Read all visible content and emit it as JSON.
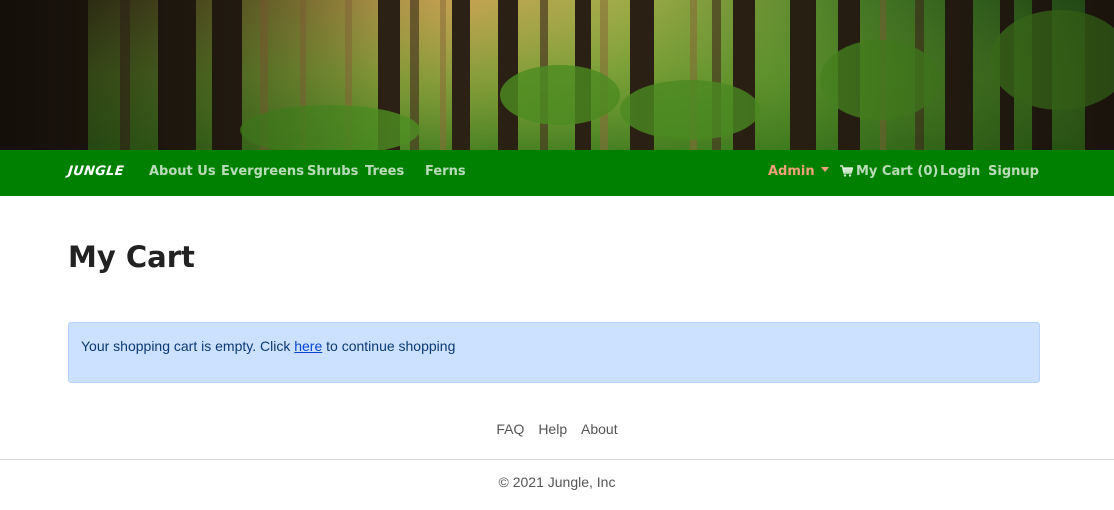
{
  "navbar": {
    "brand": "JUNGLE",
    "links": [
      "About Us",
      "Evergreens",
      "Shrubs",
      "Trees",
      "Ferns"
    ],
    "admin": "Admin",
    "cart": "My Cart (0)",
    "login": "Login",
    "signup": "Signup"
  },
  "main": {
    "title": "My Cart",
    "alert": {
      "prefix": "Your shopping cart is empty. Click ",
      "link": "here",
      "suffix": " to continue shopping"
    }
  },
  "footer": {
    "links": [
      "FAQ",
      "Help",
      "About"
    ],
    "copyright": "© 2021 Jungle, Inc"
  },
  "colors": {
    "navbar": "#008000",
    "admin_accent": "#f0a07a",
    "alert_bg": "#cce0ff",
    "alert_link": "#0645d8"
  },
  "icons": [
    "shopping-cart-icon",
    "chevron-down-icon"
  ]
}
